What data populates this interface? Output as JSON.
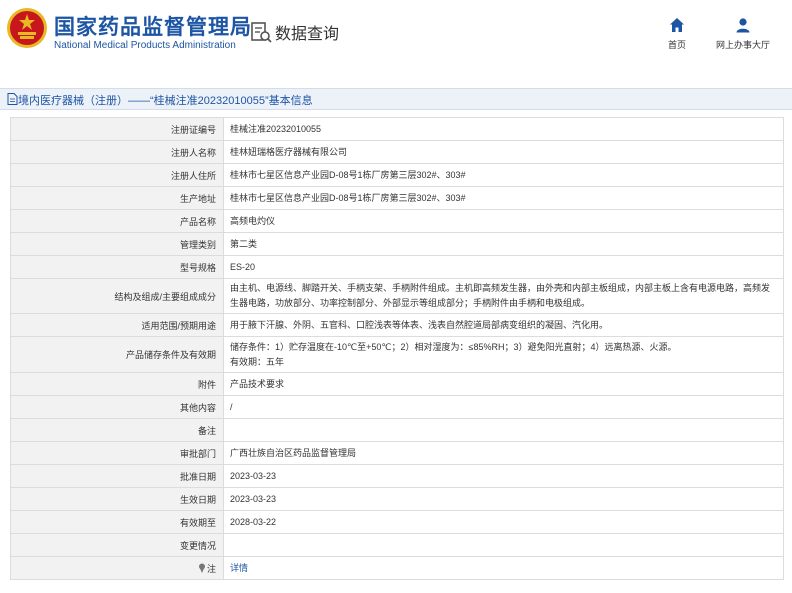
{
  "header": {
    "brand_cn": "国家药品监督管理局",
    "brand_en": "National Medical Products Administration",
    "query_title": "数据查询",
    "nav": {
      "home": "首页",
      "office": "网上办事大厅"
    }
  },
  "colors": {
    "brand": "#1d55a5",
    "seal_red": "#c8161d",
    "seal_gold": "#e8b923"
  },
  "icons": {
    "logo": "emblem-icon",
    "query": "data-query-icon",
    "home": "home-icon",
    "office": "user-icon",
    "title": "document-icon",
    "note": "pin-icon"
  },
  "title_bar": {
    "text": "境内医疗器械（注册）——“桂械注准20232010055”基本信息"
  },
  "rows": [
    {
      "key": "注册证编号",
      "value": "桂械注准20232010055"
    },
    {
      "key": "注册人名称",
      "value": "桂林妞瑞格医疗器械有限公司"
    },
    {
      "key": "注册人住所",
      "value": "桂林市七星区信息产业园D-08号1栋厂房第三层302#、303#"
    },
    {
      "key": "生产地址",
      "value": "桂林市七星区信息产业园D-08号1栋厂房第三层302#、303#"
    },
    {
      "key": "产品名称",
      "value": "高频电灼仪"
    },
    {
      "key": "管理类别",
      "value": "第二类"
    },
    {
      "key": "型号规格",
      "value": "ES-20"
    },
    {
      "key": "结构及组成/主要组成成分",
      "value": "由主机、电源线、脚踏开关、手柄支架、手柄附件组成。主机即高频发生器，由外壳和内部主板组成，内部主板上含有电源电路，高频发生器电路，功放部分、功率控制部分、外部显示等组成部分；手柄附件由手柄和电极组成。"
    },
    {
      "key": "适用范围/预期用途",
      "value": "用于腋下汗腺、外阴、五官科、口腔浅表等体表、浅表自然腔道局部病变组织的凝固、汽化用。"
    },
    {
      "key": "产品储存条件及有效期",
      "value": "储存条件：1）贮存温度在-10℃至+50℃；2）相对湿度为：≤85%RH；3）避免阳光直射；4）远离热源、火源。",
      "value2": "有效期：五年"
    },
    {
      "key": "附件",
      "value": "产品技术要求"
    },
    {
      "key": "其他内容",
      "value": "/"
    },
    {
      "key": "备注",
      "value": ""
    },
    {
      "key": "审批部门",
      "value": "广西壮族自治区药品监督管理局"
    },
    {
      "key": "批准日期",
      "value": "2023-03-23"
    },
    {
      "key": "生效日期",
      "value": "2023-03-23"
    },
    {
      "key": "有效期至",
      "value": "2028-03-22"
    },
    {
      "key": "变更情况",
      "value": ""
    },
    {
      "key": "注",
      "value": "详情"
    }
  ]
}
